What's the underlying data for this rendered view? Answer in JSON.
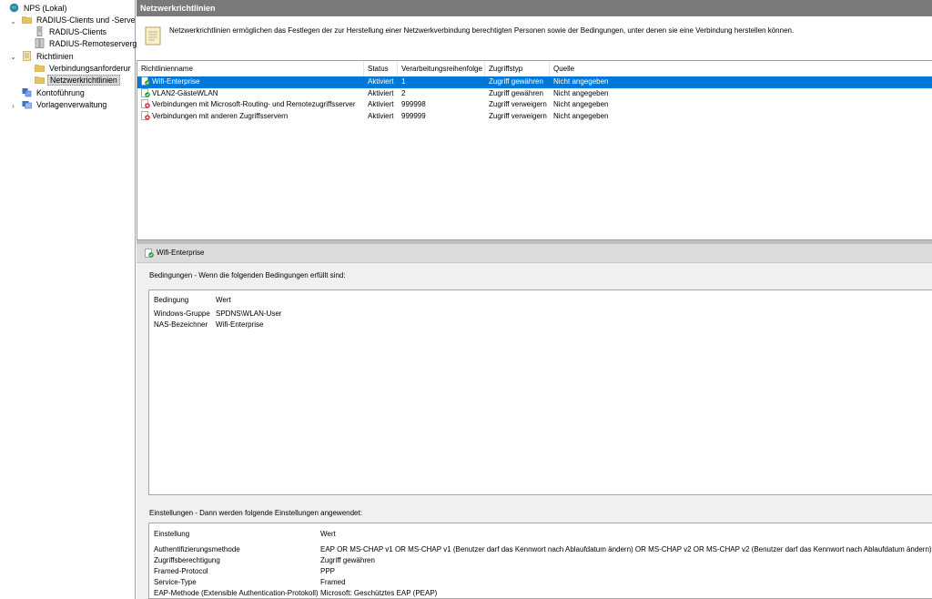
{
  "tree": {
    "root": "NPS (Lokal)",
    "radius_group": "RADIUS-Clients und -Serve",
    "radius_clients": "RADIUS-Clients",
    "radius_remote": "RADIUS-Remoteserverg",
    "policies": "Richtlinien",
    "connection_requests": "Verbindungsanforderur",
    "network_policies": "Netzwerkrichtlinien",
    "accounting": "Kontoführung",
    "templates": "Vorlagenverwaltung"
  },
  "title": "Netzwerkrichtlinien",
  "description": "Netzwerkrichtlinien ermöglichen das Festlegen der zur Herstellung einer Netzwerkverbindung berechtigten Personen sowie der Bedingungen, unter denen sie eine Verbindung herstellen können.",
  "columns": {
    "name": "Richtlinienname",
    "status": "Status",
    "order": "Verarbeitungsreihenfolge",
    "access": "Zugriffstyp",
    "source": "Quelle"
  },
  "policies": [
    {
      "name": "Wifi-Enterprise",
      "status": "Aktiviert",
      "order": "1",
      "access": "Zugriff gewähren",
      "source": "Nicht angegeben",
      "icon": "allow-policy-icon"
    },
    {
      "name": "VLAN2-GästeWLAN",
      "status": "Aktiviert",
      "order": "2",
      "access": "Zugriff gewähren",
      "source": "Nicht angegeben",
      "icon": "allow-policy-icon"
    },
    {
      "name": "Verbindungen mit Microsoft-Routing- und Remotezugriffsserver",
      "status": "Aktiviert",
      "order": "999998",
      "access": "Zugriff verweigern",
      "source": "Nicht angegeben",
      "icon": "deny-policy-icon"
    },
    {
      "name": "Verbindungen mit anderen Zugriffsservern",
      "status": "Aktiviert",
      "order": "999999",
      "access": "Zugriff verweigern",
      "source": "Nicht angegeben",
      "icon": "deny-policy-icon"
    }
  ],
  "detail": {
    "title": "Wifi-Enterprise",
    "conditions_label": "Bedingungen - Wenn die folgenden Bedingungen erfüllt sind:",
    "conditions_headers": {
      "condition": "Bedingung",
      "value": "Wert"
    },
    "conditions": [
      {
        "condition": "Windows-Gruppe",
        "value": "SPDNS\\WLAN-User"
      },
      {
        "condition": "NAS-Bezeichner",
        "value": "Wifi-Enterprise"
      }
    ],
    "settings_label": "Einstellungen - Dann werden folgende Einstellungen angewendet:",
    "settings_headers": {
      "setting": "Einstellung",
      "value": "Wert"
    },
    "settings": [
      {
        "setting": "Authentifizierungsmethode",
        "value": "EAP OR MS-CHAP v1 OR MS-CHAP v1 (Benutzer darf das Kennwort nach Ablaufdatum ändern) OR MS-CHAP v2 OR MS-CHAP v2 (Benutzer darf das Kennwort nach Ablaufdatum ändern)"
      },
      {
        "setting": "Zugriffsberechtigung",
        "value": "Zugriff gewähren"
      },
      {
        "setting": "Framed-Protocol",
        "value": "PPP"
      },
      {
        "setting": "Service-Type",
        "value": "Framed"
      },
      {
        "setting": "EAP-Methode (Extensible Authentication-Protokoll)",
        "value": "Microsoft: Geschütztes EAP (PEAP)"
      }
    ]
  },
  "colors": {
    "selection": "#0078d7",
    "title_bar": "#7a7a7a",
    "folder": "#e8c25a",
    "allow": "#2e9e3e",
    "deny": "#d22a2a"
  }
}
